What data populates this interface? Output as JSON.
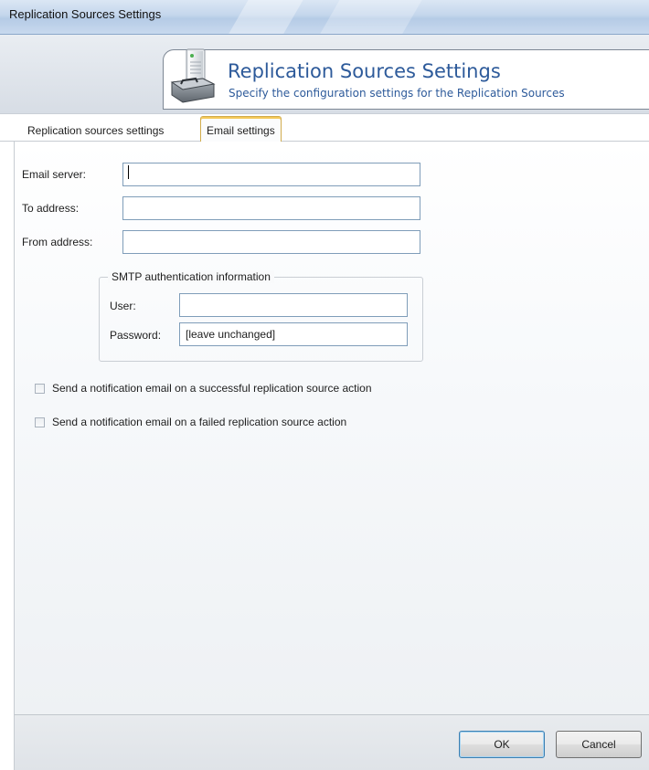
{
  "window": {
    "title": "Replication Sources Settings"
  },
  "header": {
    "title": "Replication Sources Settings",
    "subtitle": "Specify the configuration settings for the Replication Sources",
    "icon": "server-tools-icon"
  },
  "tabs": [
    {
      "label": "Replication sources settings",
      "active": false
    },
    {
      "label": "Email settings",
      "active": true
    }
  ],
  "form": {
    "email_server": {
      "label": "Email server:",
      "value": ""
    },
    "to_address": {
      "label": "To address:",
      "value": ""
    },
    "from_address": {
      "label": "From address:",
      "value": ""
    },
    "smtp": {
      "legend": "SMTP authentication information",
      "user": {
        "label": "User:",
        "value": ""
      },
      "password": {
        "label": "Password:",
        "value": "[leave unchanged]"
      }
    },
    "notify_success": {
      "label": "Send a notification email on a successful replication source action",
      "checked": false
    },
    "notify_failure": {
      "label": "Send a notification email on a failed replication source action",
      "checked": false
    }
  },
  "footer": {
    "ok_label": "OK",
    "cancel_label": "Cancel"
  }
}
